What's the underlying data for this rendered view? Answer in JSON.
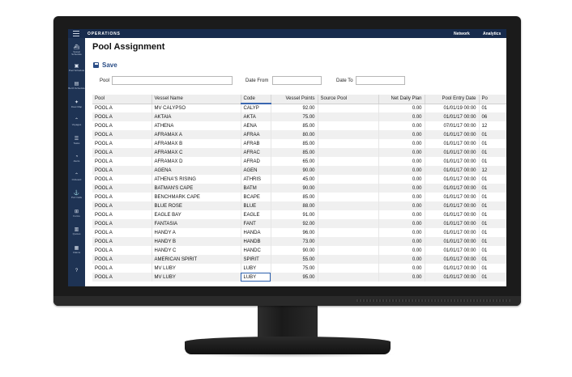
{
  "topbar": {
    "brand": "OPERATIONS",
    "links": [
      "Network",
      "Analytics"
    ]
  },
  "sidebar": {
    "items": [
      {
        "icon": "ship-icon",
        "glyph": "⛴",
        "label": "Vessel Schedule"
      },
      {
        "icon": "pool-icon",
        "glyph": "▣",
        "label": "Pool Schedule"
      },
      {
        "icon": "berth-icon",
        "glyph": "▤",
        "label": "Berth Schedule"
      },
      {
        "icon": "map-icon",
        "glyph": "✦",
        "label": "Fleet Map"
      },
      {
        "icon": "voyages-icon",
        "glyph": "⌃",
        "label": "Voyages"
      },
      {
        "icon": "tasks-icon",
        "glyph": "☰",
        "label": "Tasks"
      },
      {
        "icon": "alerts-icon",
        "glyph": "◔",
        "label": "Alerts"
      },
      {
        "icon": "onboard-icon",
        "glyph": "⌃",
        "label": "Onboard"
      },
      {
        "icon": "portcalls-icon",
        "glyph": "⚓",
        "label": "Port Calls"
      },
      {
        "icon": "forms-icon",
        "glyph": "⊞",
        "label": "Forms"
      },
      {
        "icon": "quotes-icon",
        "glyph": "▥",
        "label": "Quotes"
      },
      {
        "icon": "claims-icon",
        "glyph": "▦",
        "label": "Claims"
      },
      {
        "icon": "help-icon",
        "glyph": "?",
        "label": ""
      }
    ]
  },
  "page": {
    "title": "Pool Assignment",
    "save_label": "Save"
  },
  "filters": {
    "pool_label": "Pool",
    "date_from_label": "Date From",
    "date_to_label": "Date To",
    "pool_value": "",
    "date_from_value": "",
    "date_to_value": ""
  },
  "table": {
    "headers": [
      "Pool",
      "Vessel Name",
      "Code",
      "Vessel Points",
      "Source Pool",
      "Net Daily Plan",
      "Pool Entry Date",
      "Po"
    ],
    "rows": [
      [
        "POOL A",
        "MV CALYPSO",
        "CALYP",
        "92.00",
        "",
        "0.00",
        "01/01/19 00:00",
        "01"
      ],
      [
        "POOL A",
        "AKTAIA",
        "AKTA",
        "75.00",
        "",
        "0.00",
        "01/01/17 00:00",
        "06"
      ],
      [
        "POOL A",
        "ATHENA",
        "AENA",
        "85.00",
        "",
        "0.00",
        "07/01/17 00:00",
        "12"
      ],
      [
        "POOL A",
        "AFRAMAX A",
        "AFRAA",
        "80.00",
        "",
        "0.00",
        "01/01/17 00:00",
        "01"
      ],
      [
        "POOL A",
        "AFRAMAX B",
        "AFRAB",
        "85.00",
        "",
        "0.00",
        "01/01/17 00:00",
        "01"
      ],
      [
        "POOL A",
        "AFRAMAX C",
        "AFRAC",
        "85.00",
        "",
        "0.00",
        "01/01/17 00:00",
        "01"
      ],
      [
        "POOL A",
        "AFRAMAX D",
        "AFRAD",
        "65.00",
        "",
        "0.00",
        "01/01/17 00:00",
        "01"
      ],
      [
        "POOL A",
        "AGENA",
        "AGEN",
        "90.00",
        "",
        "0.00",
        "01/01/17 00:00",
        "12"
      ],
      [
        "POOL A",
        "ATHENA'S RISING",
        "ATHRIS",
        "45.00",
        "",
        "0.00",
        "01/01/17 00:00",
        "01"
      ],
      [
        "POOL A",
        "BATMAN'S CAPE",
        "BATM",
        "90.00",
        "",
        "0.00",
        "01/01/17 00:00",
        "01"
      ],
      [
        "POOL A",
        "BENCHMARK CAPE",
        "BCAPE",
        "85.00",
        "",
        "0.00",
        "01/01/17 00:00",
        "01"
      ],
      [
        "POOL A",
        "BLUE ROSE",
        "BLUE",
        "88.00",
        "",
        "0.00",
        "01/01/17 00:00",
        "01"
      ],
      [
        "POOL A",
        "EAGLE BAY",
        "EAGLE",
        "91.00",
        "",
        "0.00",
        "01/01/17 00:00",
        "01"
      ],
      [
        "POOL A",
        "FANTASIA",
        "FANT",
        "92.00",
        "",
        "0.00",
        "01/01/17 00:00",
        "01"
      ],
      [
        "POOL A",
        "HANDY A",
        "HANDA",
        "96.00",
        "",
        "0.00",
        "01/01/17 00:00",
        "01"
      ],
      [
        "POOL A",
        "HANDY B",
        "HANDB",
        "73.00",
        "",
        "0.00",
        "01/01/17 00:00",
        "01"
      ],
      [
        "POOL A",
        "HANDY C",
        "HANDC",
        "90.00",
        "",
        "0.00",
        "01/01/17 00:00",
        "01"
      ],
      [
        "POOL A",
        "AMERICAN SPIRIT",
        "SPIRIT",
        "55.00",
        "",
        "0.00",
        "01/01/17 00:00",
        "01"
      ],
      [
        "POOL A",
        "MV LUBY",
        "LUBY",
        "75.00",
        "",
        "0.00",
        "01/01/17 00:00",
        "01"
      ],
      [
        "POOL A",
        "MV LUBY",
        "LUBY",
        "95.00",
        "",
        "0.00",
        "01/01/17 00:00",
        "01"
      ]
    ],
    "selected_row": 19
  },
  "colors": {
    "topbar": "#172b4d",
    "sidebar": "#1e3354",
    "accent": "#2a4d86",
    "bezel": "#1b1b1b"
  }
}
